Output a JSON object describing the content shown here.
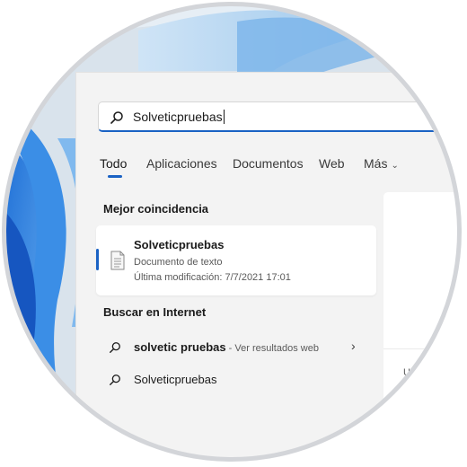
{
  "search": {
    "query": "Solveticpruebas"
  },
  "tabs": [
    {
      "label": "Todo"
    },
    {
      "label": "Aplicaciones"
    },
    {
      "label": "Documentos"
    },
    {
      "label": "Web"
    },
    {
      "label": "Más"
    }
  ],
  "best_match": {
    "section_title": "Mejor coincidencia",
    "title": "Solveticpruebas",
    "type": "Documento de texto",
    "modified": "Última modificación: 7/7/2021 17:01"
  },
  "internet": {
    "section_title": "Buscar en Internet",
    "results": [
      {
        "bold": "solvetic pruebas",
        "hint": " - Ver resultados web"
      },
      {
        "bold": "",
        "plain": "Solveticpruebas"
      }
    ]
  },
  "preview": {
    "partial_label": "Ubi"
  },
  "colors": {
    "accent": "#1a62c4",
    "wallpaper": "#2d7be0"
  }
}
